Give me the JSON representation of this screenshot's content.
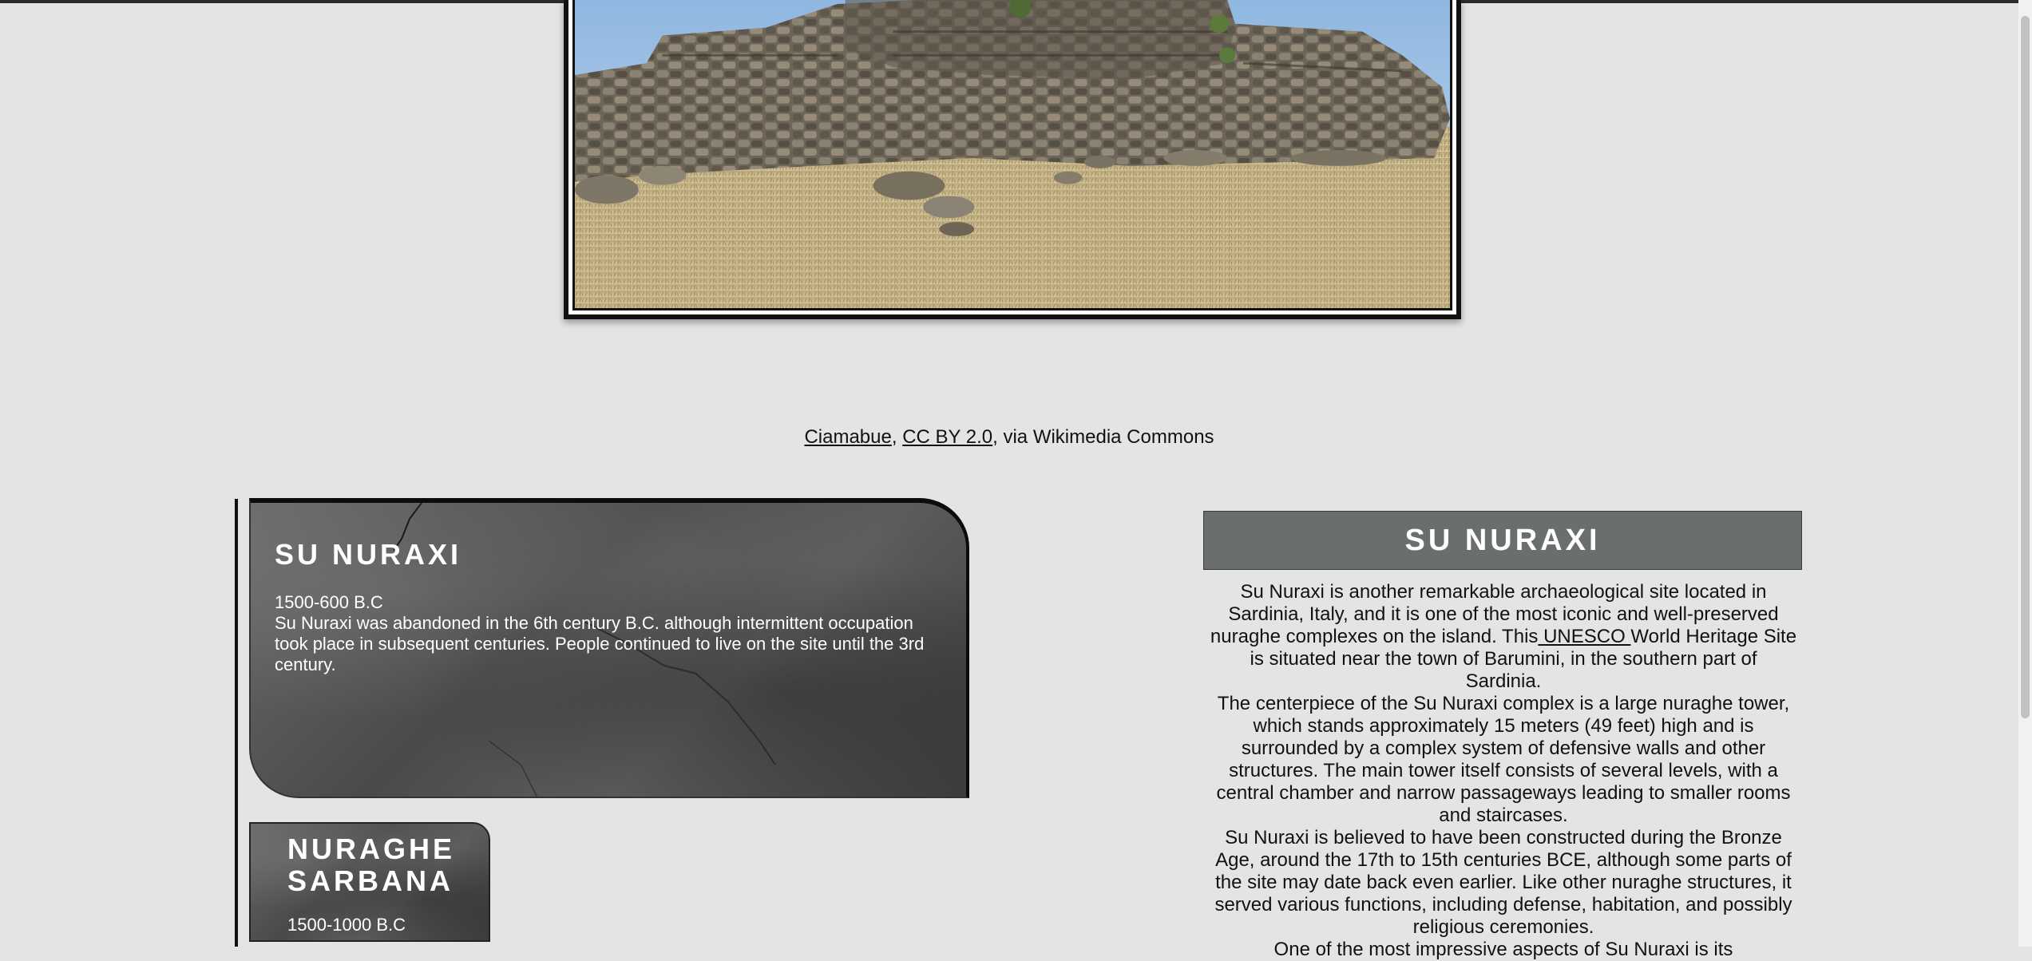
{
  "credit": {
    "author": "Ciamabue",
    "separator1": ", ",
    "license": "CC BY 2.0",
    "suffix": ", via Wikimedia Commons"
  },
  "photo": {
    "subject": "Su Nuraxi nuraghe ruins"
  },
  "timeline": {
    "cards": [
      {
        "title": "SU NURAXI",
        "date": "1500-600 B.C",
        "text": "Su Nuraxi was abandoned in the 6th century B.C. although intermittent occupation took place in subsequent centuries. People continued to live on the site until the 3rd century."
      },
      {
        "title": "NURAGHE SARBANA",
        "date": "1500-1000 B.C"
      }
    ]
  },
  "info": {
    "heading": "SU NURAXI",
    "p1_before_link": "Su Nuraxi is another remarkable archaeological site located in Sardinia, Italy, and it is one of the most iconic and well-preserved nuraghe complexes on the island. This",
    "p1_link": " UNESCO ",
    "p1_after_link": "World Heritage Site is situated near the town of Barumini, in the southern part of Sardinia.",
    "p2": "The centerpiece of the Su Nuraxi complex is a large nuraghe tower, which stands approximately 15 meters (49 feet) high and is surrounded by a complex system of defensive walls and other structures. The main tower itself consists of several levels, with a central chamber and narrow passageways leading to smaller rooms and staircases.",
    "p3": "Su Nuraxi is believed to have been constructed during the Bronze Age, around the 17th to 15th centuries BCE, although some parts of the site may date back even earlier. Like other nuraghe structures, it served various functions, including defense, habitation, and possibly religious ceremonies.",
    "p4": "One of the most impressive aspects of Su Nuraxi is its"
  }
}
